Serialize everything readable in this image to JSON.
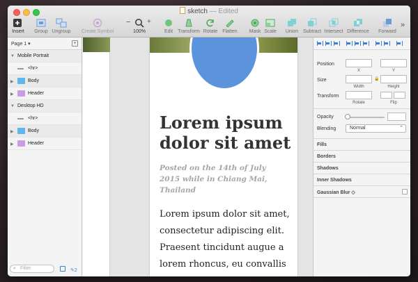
{
  "window": {
    "title": "sketch",
    "title_status": "Edited",
    "separator": "—"
  },
  "toolbar": {
    "insert": "Insert",
    "group": "Group",
    "ungroup": "Ungroup",
    "create_symbol": "Create Symbol",
    "zoom_minus": "−",
    "zoom_plus": "+",
    "zoom_level": "100%",
    "edit": "Edit",
    "transform": "Transform",
    "rotate": "Rotate",
    "flatten": "Flatten",
    "mask": "Mask",
    "scale": "Scale",
    "union": "Union",
    "subtract": "Subtract",
    "intersect": "Intersect",
    "difference": "Difference",
    "forward": "Forward",
    "overflow": "»"
  },
  "layers": {
    "page_selector": "Page 1 ▾",
    "add_page": "+",
    "items": [
      {
        "label": "Mobile Portrait",
        "kind": "artboard"
      },
      {
        "label": "<hr>",
        "kind": "hr"
      },
      {
        "label": "Body",
        "kind": "folder-blue"
      },
      {
        "label": "Header",
        "kind": "folder-purple"
      },
      {
        "label": "Desktop HD",
        "kind": "artboard"
      },
      {
        "label": "<hr>",
        "kind": "hr"
      },
      {
        "label": "Body",
        "kind": "folder-blue"
      },
      {
        "label": "Header",
        "kind": "folder-purple"
      }
    ],
    "filter_placeholder": "Filter",
    "filter_count": "2"
  },
  "canvas": {
    "post_title": "Lorem ipsum dolor sit amet",
    "post_meta": "Posted on the 14th of July 2015 while in Chiang Mai, Thailand",
    "post_body": "Lorem ipsum dolor sit amet, consectetur adipiscing elit. Praesent tincidunt augue a lorem rhoncus, eu convallis"
  },
  "inspector": {
    "position": "Position",
    "x": "X",
    "y": "Y",
    "size": "Size",
    "width": "Width",
    "height": "Height",
    "transform": "Transform",
    "rotate": "Rotate",
    "flip": "Flip",
    "opacity": "Opacity",
    "blending": "Blending",
    "blending_value": "Normal",
    "fills": "Fills",
    "borders": "Borders",
    "shadows": "Shadows",
    "inner_shadows": "Inner Shadows",
    "gaussian_blur": "Gaussian Blur ◇"
  },
  "colors": {
    "accent": "#3d7fd6",
    "avatar": "#5b94dc",
    "folder_body": "#5fb6ec",
    "folder_header": "#c89de5"
  }
}
